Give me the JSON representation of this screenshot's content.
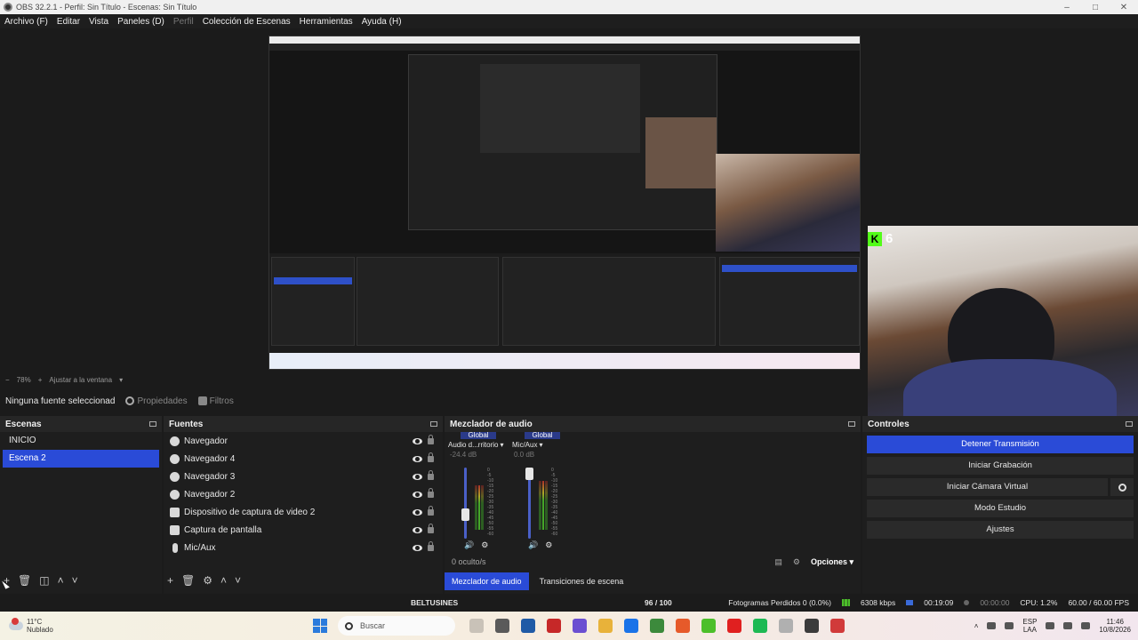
{
  "window": {
    "title": "OBS 32.2.1 - Perfil: Sin Título - Escenas: Sin Título"
  },
  "menu": [
    {
      "label": "Archivo (F)",
      "enabled": true
    },
    {
      "label": "Editar",
      "enabled": true
    },
    {
      "label": "Vista",
      "enabled": true
    },
    {
      "label": "Paneles (D)",
      "enabled": true
    },
    {
      "label": "Perfil",
      "enabled": false
    },
    {
      "label": "Colección de Escenas",
      "enabled": true
    },
    {
      "label": "Herramientas",
      "enabled": true
    },
    {
      "label": "Ayuda (H)",
      "enabled": true
    }
  ],
  "overlay": {
    "kick_count": "6"
  },
  "preview": {
    "zoom": "78%",
    "fit_label": "Ajustar a la ventana"
  },
  "source_toolbar": {
    "no_selection": "Ninguna fuente seleccionad",
    "properties": "Propiedades",
    "filters": "Filtros"
  },
  "scenes": {
    "title": "Escenas",
    "items": [
      {
        "label": "INICIO",
        "selected": false
      },
      {
        "label": "Escena 2",
        "selected": true
      }
    ]
  },
  "sources": {
    "title": "Fuentes",
    "items": [
      {
        "label": "Navegador",
        "icon": "browser-icon"
      },
      {
        "label": "Navegador 4",
        "icon": "browser-icon"
      },
      {
        "label": "Navegador 3",
        "icon": "browser-icon"
      },
      {
        "label": "Navegador 2",
        "icon": "browser-icon"
      },
      {
        "label": "Dispositivo de captura de video 2",
        "icon": "camera-icon"
      },
      {
        "label": "Captura de pantalla",
        "icon": "monitor-icon"
      },
      {
        "label": "Mic/Aux",
        "icon": "microphone-icon"
      }
    ]
  },
  "mixer": {
    "title": "Mezclador de audio",
    "channels": [
      {
        "scope": "Global",
        "device": "Audio d...rritorio",
        "db": "-24.4 dB",
        "level": 0.3,
        "meter": 0.72
      },
      {
        "scope": "Global",
        "device": "Mic/Aux",
        "db": "0.0 dB",
        "level": 1.0,
        "meter": 0.78
      }
    ],
    "ticks": [
      "0",
      "-5",
      "-10",
      "-15",
      "-20",
      "-25",
      "-30",
      "-35",
      "-40",
      "-45",
      "-50",
      "-55",
      "-60"
    ],
    "hidden_count": "0 oculto/s",
    "options_label": "Opciones",
    "tabs": [
      {
        "label": "Mezclador de audio",
        "active": true
      },
      {
        "label": "Transiciones de escena",
        "active": false
      }
    ]
  },
  "controls": {
    "title": "Controles",
    "stop_stream": "Detener Transmisión",
    "start_recording": "Iniciar Grabación",
    "start_virtual_cam": "Iniciar Cámara Virtual",
    "studio_mode": "Modo Estudio",
    "settings": "Ajustes"
  },
  "status": {
    "center_label": "BELTUSINES",
    "fraction": "96 / 100",
    "dropped": "Fotogramas Perdidos 0 (0.0%)",
    "bitrate": "6308 kbps",
    "live_time": "00:19:09",
    "rec_time": "00:00:00",
    "cpu": "CPU: 1.2%",
    "fps": "60.00 / 60.00 FPS"
  },
  "taskbar": {
    "weather_temp": "11°C",
    "weather_desc": "Nublado",
    "search_placeholder": "Buscar",
    "lang_top": "ESP",
    "lang_bottom": "LAA",
    "time": "11:46",
    "date": "10/8/2026",
    "app_colors": [
      "#c9c2b8",
      "#5a5a5a",
      "#1f5aa6",
      "#c62828",
      "#6b4fd1",
      "#e8b23a",
      "#1a73e8",
      "#3c8a3c",
      "#e65a2a",
      "#4cbf2a",
      "#e02020",
      "#1db954",
      "#b0b0b0",
      "#3b3b3b",
      "#d13a3a"
    ]
  },
  "colors": {
    "accent": "#2a4bd7",
    "meter_green": "#4cbf2a",
    "kick_green": "#53fc18"
  }
}
